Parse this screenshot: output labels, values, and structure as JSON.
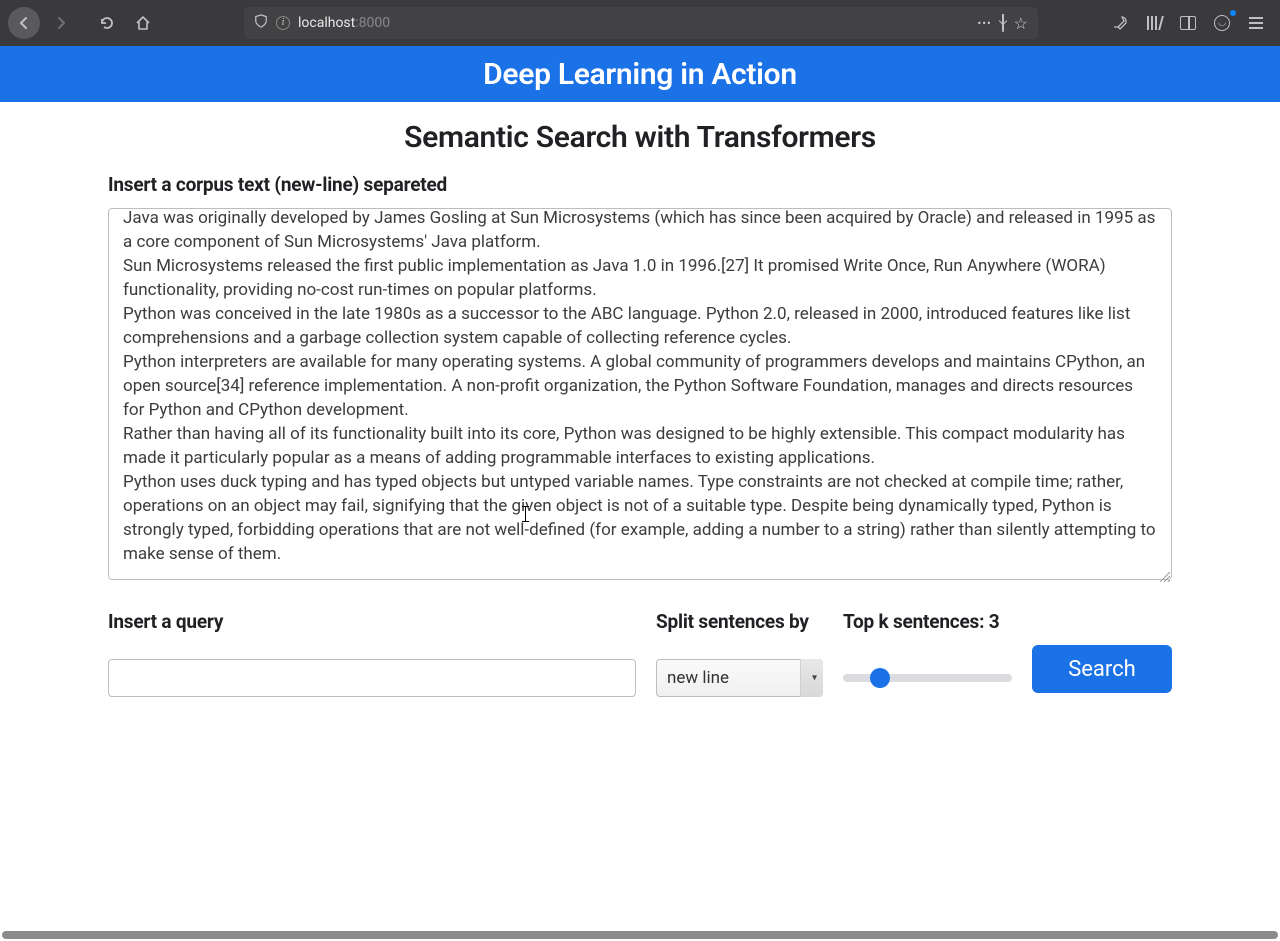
{
  "browser": {
    "url_host": "localhost",
    "url_port": ":8000",
    "ellipsis": "•••"
  },
  "header": {
    "title": "Deep Learning in Action"
  },
  "page": {
    "title": "Semantic Search with Transformers",
    "corpus_label": "Insert a corpus text (new-line) separeted",
    "corpus_value": "Java was originally developed by James Gosling at Sun Microsystems (which has since been acquired by Oracle) and released in 1995 as a core component of Sun Microsystems' Java platform.\nSun Microsystems released the first public implementation as Java 1.0 in 1996.[27] It promised Write Once, Run Anywhere (WORA) functionality, providing no-cost run-times on popular platforms.\nPython was conceived in the late 1980s as a successor to the ABC language. Python 2.0, released in 2000, introduced features like list comprehensions and a garbage collection system capable of collecting reference cycles.\nPython interpreters are available for many operating systems. A global community of programmers develops and maintains CPython, an open source[34] reference implementation. A non-profit organization, the Python Software Foundation, manages and directs resources for Python and CPython development.\nRather than having all of its functionality built into its core, Python was designed to be highly extensible. This compact modularity has made it particularly popular as a means of adding programmable interfaces to existing applications.\nPython uses duck typing and has typed objects but untyped variable names. Type constraints are not checked at compile time; rather, operations on an object may fail, signifying that the given object is not of a suitable type. Despite being dynamically typed, Python is strongly typed, forbidding operations that are not well-defined (for example, adding a number to a string) rather than silently attempting to make sense of them.",
    "query_label": "Insert a query",
    "query_value": "",
    "split_label": "Split sentences by",
    "split_value": "new line",
    "topk_label_prefix": "Top k sentences: ",
    "topk_value": "3",
    "search_label": "Search"
  },
  "colors": {
    "accent": "#1b72e7"
  }
}
